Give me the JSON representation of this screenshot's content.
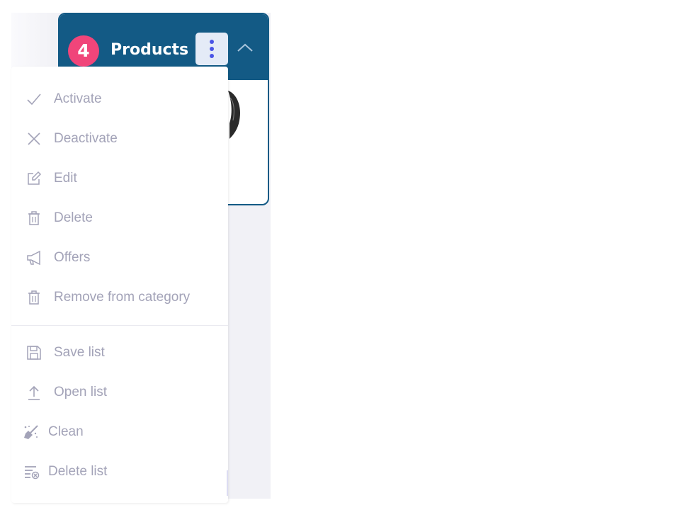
{
  "header": {
    "count": "4",
    "title": "Products"
  },
  "icons": {
    "menu_button": "more-vertical-icon",
    "collapse": "chevron-up-icon"
  },
  "colors": {
    "header_bg": "#135a85",
    "badge_bg": "#f0457a",
    "menu_text": "#a3a3b8",
    "kebab_dots": "#4a55e6"
  },
  "menu": {
    "group_actions": [
      {
        "label": "Activate",
        "icon": "check-icon"
      },
      {
        "label": "Deactivate",
        "icon": "close-icon"
      },
      {
        "label": "Edit",
        "icon": "edit-icon"
      },
      {
        "label": "Delete",
        "icon": "trash-icon"
      },
      {
        "label": "Offers",
        "icon": "megaphone-icon"
      },
      {
        "label": "Remove from category",
        "icon": "trash-icon"
      }
    ],
    "group_list": [
      {
        "label": "Save list",
        "icon": "save-icon"
      },
      {
        "label": "Open list",
        "icon": "upload-icon"
      },
      {
        "label": "Clean",
        "icon": "broom-icon"
      },
      {
        "label": "Delete list",
        "icon": "delete-list-icon"
      }
    ]
  }
}
